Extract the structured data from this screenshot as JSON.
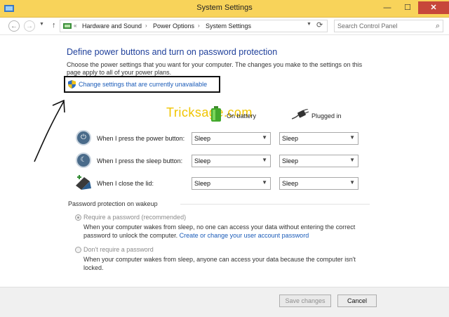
{
  "window": {
    "title": "System Settings",
    "min": "—",
    "max": "☐",
    "close": "✕"
  },
  "nav": {
    "back": "←",
    "forward": "→",
    "up": "↑",
    "prefix": "«",
    "breadcrumbs": [
      "Hardware and Sound",
      "Power Options",
      "System Settings"
    ],
    "sep": "›",
    "refresh": "⟳",
    "search_placeholder": "Search Control Panel",
    "search_icon": "⌕"
  },
  "content": {
    "heading": "Define power buttons and turn on password protection",
    "description": "Choose the power settings that you want for your computer. The changes you make to the settings on this page apply to all of your power plans.",
    "change_link": "Change settings that are currently unavailable",
    "watermark": "Tricksage.com"
  },
  "columns": {
    "battery": "On battery",
    "plugged": "Plugged in"
  },
  "rows": [
    {
      "label": "When I press the power button:",
      "icon": "power-icon",
      "battery": "Sleep",
      "plugged": "Sleep"
    },
    {
      "label": "When I press the sleep button:",
      "icon": "sleep-icon",
      "battery": "Sleep",
      "plugged": "Sleep"
    },
    {
      "label": "When I close the lid:",
      "icon": "laptop-lid-icon",
      "battery": "Sleep",
      "plugged": "Sleep"
    }
  ],
  "password": {
    "section_title": "Password protection on wakeup",
    "require_label": "Require a password (recommended)",
    "require_text": "When your computer wakes from sleep, no one can access your data without entering the correct password to unlock the computer.",
    "require_link": "Create or change your user account password",
    "norequire_label": "Don't require a password",
    "norequire_text": "When your computer wakes from sleep, anyone can access your data because the computer isn't locked."
  },
  "footer": {
    "save": "Save changes",
    "cancel": "Cancel"
  },
  "colors": {
    "titlebar": "#f8d35a",
    "heading": "#1e3f9a",
    "link": "#1a5bb8",
    "close": "#c7473a"
  }
}
